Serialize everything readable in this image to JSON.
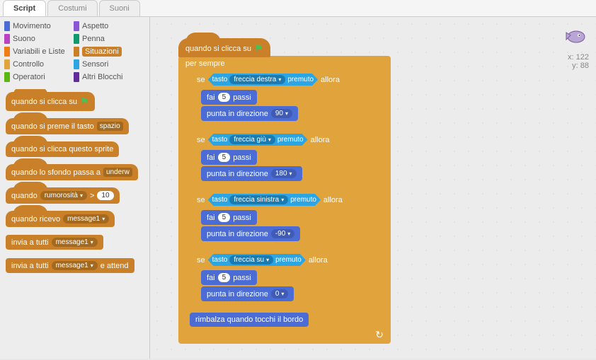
{
  "tabs": [
    "Script",
    "Costumi",
    "Suoni"
  ],
  "active_tab": 0,
  "categories": [
    {
      "name": "Movimento",
      "color": "#4a6cd4"
    },
    {
      "name": "Aspetto",
      "color": "#8a55d7"
    },
    {
      "name": "Suono",
      "color": "#bb42c3"
    },
    {
      "name": "Penna",
      "color": "#0e9a6c"
    },
    {
      "name": "Variabili e Liste",
      "color": "#ee7d16"
    },
    {
      "name": "Situazioni",
      "color": "#c98028",
      "active": true
    },
    {
      "name": "Controllo",
      "color": "#e1a33c"
    },
    {
      "name": "Sensori",
      "color": "#2ca5e2"
    },
    {
      "name": "Operatori",
      "color": "#5cb712"
    },
    {
      "name": "Altri Blocchi",
      "color": "#632d99"
    }
  ],
  "palette": {
    "when_flag": "quando si clicca su",
    "when_key": "quando si preme il tasto",
    "when_key_arg": "spazio",
    "when_sprite": "quando si clicca questo sprite",
    "when_backdrop": "quando lo sfondo passa a",
    "when_backdrop_arg": "underw",
    "when_sensor": "quando",
    "when_sensor_arg": "rumorosità",
    "when_sensor_gt": ">",
    "when_sensor_val": "10",
    "when_receive": "quando ricevo",
    "when_receive_arg": "message1",
    "broadcast": "invia a tutti",
    "broadcast_arg": "message1",
    "broadcast_wait": "invia a tutti",
    "broadcast_wait_arg": "message1",
    "broadcast_wait_suffix": "e attend"
  },
  "sprite_info": {
    "x_label": "x:",
    "x": "122",
    "y_label": "y:",
    "y": "88"
  },
  "script": {
    "hat": "quando si clicca su",
    "forever": "per sempre",
    "if": "se",
    "then": "allora",
    "key_word": "tasto",
    "pressed": "premuto",
    "move_prefix": "fai",
    "move_suffix": "passi",
    "point_prefix": "punta in direzione",
    "bounce": "rimbalza quando tocchi il bordo",
    "branches": [
      {
        "key": "freccia destra",
        "steps": "5",
        "dir": "90"
      },
      {
        "key": "freccia giù",
        "steps": "5",
        "dir": "180"
      },
      {
        "key": "freccia sinistra",
        "steps": "5",
        "dir": "-90"
      },
      {
        "key": "freccia su",
        "steps": "5",
        "dir": "0"
      }
    ]
  }
}
